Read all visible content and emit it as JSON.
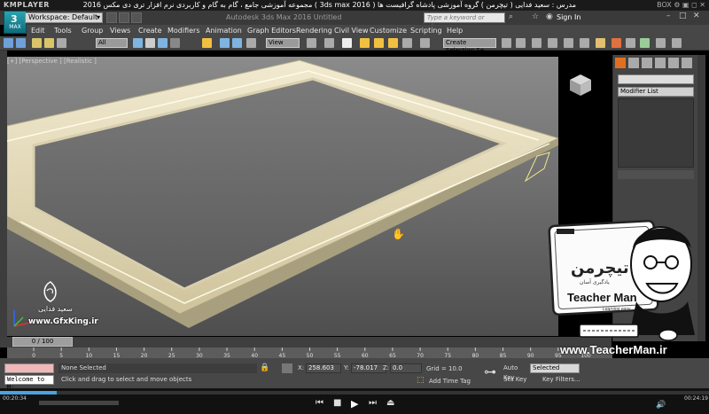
{
  "player": {
    "logo": "KMPLAYER",
    "title": "مجموعه آموزشی جامع ، گام به گام و کاربردی نرم افزار تری دی مکس 2016 ( 3ds max 2016 ) مدرس : سعید فدایی ( تیچرمن ) گروه آموزشی پادشاه گرافیست ها",
    "controls": "BOX ⚙ ▣ ◻ ✕",
    "time_current": "00:20:34",
    "time_total": "00:24:19",
    "progress_fraction": 0.08
  },
  "app": {
    "logo_label": "MAX",
    "workspace": "Workspace: Default",
    "title": "Autodesk 3ds Max 2016    Untitled",
    "search_placeholder": "Type a keyword or phrase",
    "sign_in": "Sign In"
  },
  "menu": [
    "Edit",
    "Tools",
    "Group",
    "Views",
    "Create",
    "Modifiers",
    "Animation",
    "Graph Editors",
    "Rendering",
    "Civil View",
    "Customize",
    "Scripting",
    "Help"
  ],
  "toolbar": {
    "filter": "All",
    "coord_system": "View",
    "selection_set": "Create Selection Se"
  },
  "viewport": {
    "label": "[+] [Perspective ] [Realistic ]"
  },
  "command_panel": {
    "modifier_list": "Modifier List"
  },
  "timeline": {
    "slider": "0 / 100",
    "ticks": [
      "0",
      "5",
      "10",
      "15",
      "20",
      "25",
      "30",
      "35",
      "40",
      "45",
      "50",
      "55",
      "60",
      "65",
      "70",
      "75",
      "80",
      "85",
      "90",
      "95",
      "100"
    ]
  },
  "status": {
    "welcome": "Welcome to M:",
    "selection": "None Selected",
    "prompt": "Click and drag to select and move objects",
    "x_label": "X:",
    "x": "258.603",
    "y_label": "Y:",
    "y": "-78.017",
    "z_label": "Z:",
    "z": "0.0",
    "grid": "Grid = 10.0",
    "add_time_tag": "Add Time Tag",
    "auto_key": "Auto Key",
    "key_mode": "Selected",
    "set_key": "Set Key",
    "key_filters": "Key Filters..."
  },
  "watermarks": {
    "teacher_brand": "تیچرمن",
    "teacher_tagline": "یادگیری آسان",
    "teacher_name": "Teacher Man",
    "teacher_learning": "Learning easy",
    "site": "www.TeacherMan.ir",
    "author": "سعید فدایی",
    "gfx": "www.GfxKing.ir"
  },
  "colors": {
    "frame": "#e3d9b6",
    "frame_shade": "#a89f7f",
    "accent": "#1f9bbd",
    "maxscript": "#f0b8b8"
  }
}
